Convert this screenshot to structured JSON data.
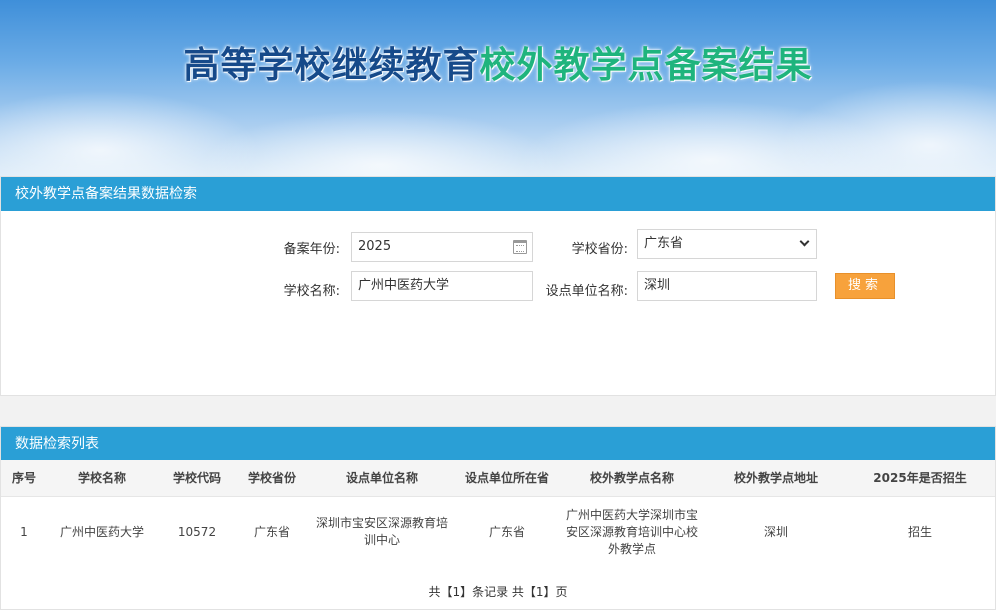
{
  "banner": {
    "title_part1": "高等学校继续教育",
    "title_part2": "校外教学点备案结果"
  },
  "search_panel": {
    "heading": "校外教学点备案结果数据检索",
    "year_label": "备案年份:",
    "year_value": "2025",
    "province_label": "学校省份:",
    "province_value": "广东省",
    "school_label": "学校名称:",
    "school_value": "广州中医药大学",
    "unit_label": "设点单位名称:",
    "unit_value": "深圳",
    "search_button": "搜索"
  },
  "list_panel": {
    "heading": "数据检索列表",
    "columns": [
      "序号",
      "学校名称",
      "学校代码",
      "学校省份",
      "设点单位名称",
      "设点单位所在省",
      "校外教学点名称",
      "校外教学点地址",
      "2025年是否招生"
    ],
    "rows": [
      [
        "1",
        "广州中医药大学",
        "10572",
        "广东省",
        "深圳市宝安区深源教育培训中心",
        "广东省",
        "广州中医药大学深圳市宝安区深源教育培训中心校外教学点",
        "深圳",
        "招生"
      ]
    ],
    "pager_text": "共【1】条记录 共【1】页"
  }
}
